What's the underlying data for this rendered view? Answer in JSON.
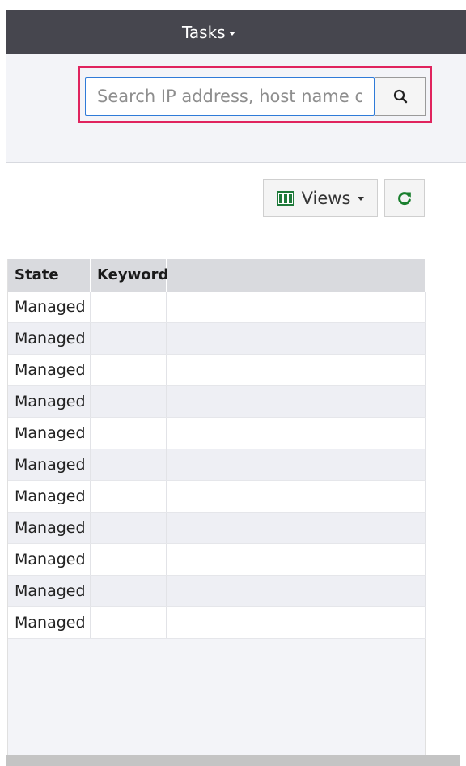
{
  "topbar": {
    "tasks_label": "Tasks"
  },
  "search": {
    "placeholder": "Search IP address, host name or"
  },
  "toolbar": {
    "views_label": "Views"
  },
  "table": {
    "columns": [
      "State",
      "Keyword",
      ""
    ],
    "rows": [
      {
        "state": "Managed",
        "keyword": ""
      },
      {
        "state": "Managed",
        "keyword": ""
      },
      {
        "state": "Managed",
        "keyword": ""
      },
      {
        "state": "Managed",
        "keyword": ""
      },
      {
        "state": "Managed",
        "keyword": ""
      },
      {
        "state": "Managed",
        "keyword": ""
      },
      {
        "state": "Managed",
        "keyword": ""
      },
      {
        "state": "Managed",
        "keyword": ""
      },
      {
        "state": "Managed",
        "keyword": ""
      },
      {
        "state": "Managed",
        "keyword": ""
      },
      {
        "state": "Managed",
        "keyword": ""
      }
    ]
  },
  "icons": {
    "search": "search-icon",
    "views": "columns-icon",
    "refresh": "refresh-icon",
    "caret": "caret-down-icon"
  },
  "colors": {
    "topbar": "#46464e",
    "highlight": "#e0245e",
    "input_border": "#2f7bd8",
    "refresh_green": "#1a7f2e",
    "views_icon_green": "#1f7a3a"
  }
}
